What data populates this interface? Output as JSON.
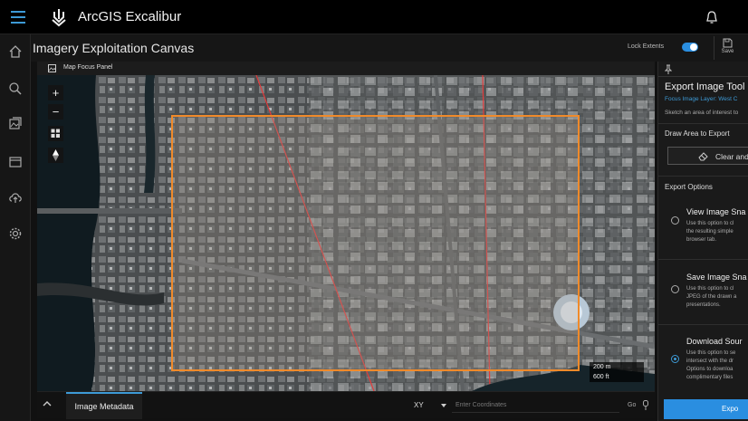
{
  "app": {
    "title": "ArcGIS Excalibur"
  },
  "header": {
    "title": "Imagery Exploitation Canvas",
    "lock_extents_label": "Lock Extents",
    "lock_extents_on": true,
    "save_label": "Save"
  },
  "nav": {
    "icons": [
      "home-icon",
      "search-icon",
      "image-library-icon",
      "projects-icon",
      "cloud-upload-icon",
      "settings-icon"
    ]
  },
  "map_panel": {
    "header_label": "Map Focus Panel",
    "controls": {
      "zoom_in": "+",
      "zoom_out": "−"
    },
    "scale_bar": {
      "metric": "200 m",
      "imperial": "600 ft"
    }
  },
  "bottom_bar": {
    "metadata_tab": "Image Metadata",
    "coord_format": "XY",
    "coord_placeholder": "Enter Coordinates",
    "go_label": "Go"
  },
  "export_tool": {
    "title": "Export Image Tool",
    "subtitle": "Focus Image Layer: West C",
    "hint": "Sketch an area of interest to",
    "draw_section": "Draw Area to Export",
    "clear_button": "Clear and",
    "options_section": "Export Options",
    "options": [
      {
        "title": "View Image Sna",
        "lines": [
          "Use this option to cl",
          "the resulting simple",
          "browser tab."
        ],
        "selected": false
      },
      {
        "title": "Save Image Sna",
        "lines": [
          "Use this option to cl",
          "JPEG of the drawn a",
          "presentations."
        ],
        "selected": false
      },
      {
        "title": "Download Sour",
        "lines": [
          "Use this option to se",
          "intersect with the dr",
          "Options to downloa",
          "complimentary files"
        ],
        "selected": true
      }
    ],
    "export_button": "Expo"
  },
  "colors": {
    "accent": "#2a8ee0",
    "export_outline": "#f08a2a",
    "map_line": "#e23b3b"
  }
}
